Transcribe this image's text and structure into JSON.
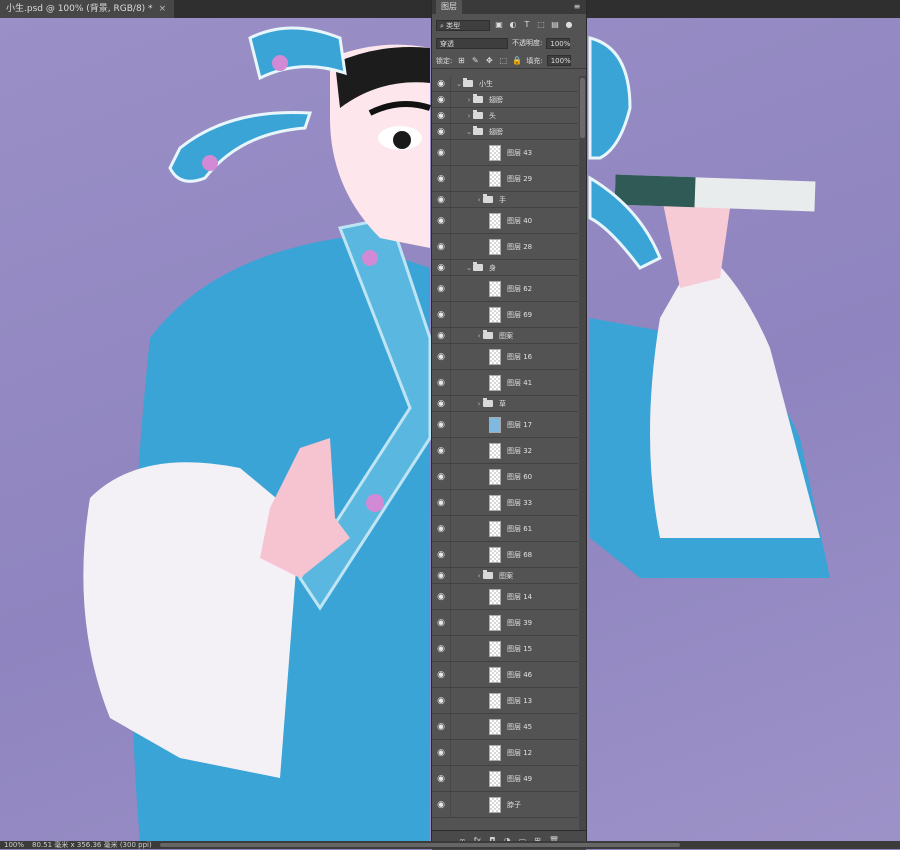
{
  "document": {
    "tab_title": "小生.psd @ 100% (背景, RGB/8) *",
    "close_glyph": "×"
  },
  "status_bar": {
    "zoom": "100%",
    "doc_size": "80.51 毫米 x 356.36 毫米 (300 ppi)"
  },
  "layers_panel": {
    "title": "图层",
    "filter_kind": "类型",
    "blend_mode": "穿透",
    "opacity_label": "不透明度:",
    "opacity_value": "100%",
    "lock_label": "锁定:",
    "fill_label": "填充:",
    "fill_value": "100%",
    "layers": [
      {
        "type": "group",
        "name": "小生",
        "indent": 0,
        "open": true
      },
      {
        "type": "group",
        "name": "翅膀",
        "indent": 1,
        "open": false
      },
      {
        "type": "group",
        "name": "头",
        "indent": 1,
        "open": false
      },
      {
        "type": "group",
        "name": "翅膀",
        "indent": 1,
        "open": true
      },
      {
        "type": "pixel",
        "name": "图层 43",
        "indent": 2
      },
      {
        "type": "pixel",
        "name": "图层 29",
        "indent": 2
      },
      {
        "type": "group",
        "name": "手",
        "indent": 2,
        "open": false
      },
      {
        "type": "pixel",
        "name": "图层 40",
        "indent": 2
      },
      {
        "type": "pixel",
        "name": "图层 28",
        "indent": 2
      },
      {
        "type": "group",
        "name": "身",
        "indent": 1,
        "open": true
      },
      {
        "type": "pixel",
        "name": "图层 62",
        "indent": 2
      },
      {
        "type": "pixel",
        "name": "图层 69",
        "indent": 2
      },
      {
        "type": "group",
        "name": "图案",
        "indent": 2,
        "open": false
      },
      {
        "type": "pixel",
        "name": "图层 16",
        "indent": 2
      },
      {
        "type": "pixel",
        "name": "图层 41",
        "indent": 2
      },
      {
        "type": "group",
        "name": "草",
        "indent": 2,
        "open": false
      },
      {
        "type": "pixel",
        "name": "图层 17",
        "indent": 2,
        "thumb": "blue"
      },
      {
        "type": "pixel",
        "name": "图层 32",
        "indent": 2
      },
      {
        "type": "pixel",
        "name": "图层 60",
        "indent": 2
      },
      {
        "type": "pixel",
        "name": "图层 33",
        "indent": 2
      },
      {
        "type": "pixel",
        "name": "图层 61",
        "indent": 2
      },
      {
        "type": "pixel",
        "name": "图层 68",
        "indent": 2
      },
      {
        "type": "group",
        "name": "图案",
        "indent": 2,
        "open": false
      },
      {
        "type": "pixel",
        "name": "图层 14",
        "indent": 2
      },
      {
        "type": "pixel",
        "name": "图层 39",
        "indent": 2
      },
      {
        "type": "pixel",
        "name": "图层 15",
        "indent": 2
      },
      {
        "type": "pixel",
        "name": "图层 46",
        "indent": 2
      },
      {
        "type": "pixel",
        "name": "图层 13",
        "indent": 2
      },
      {
        "type": "pixel",
        "name": "图层 45",
        "indent": 2
      },
      {
        "type": "pixel",
        "name": "图层 12",
        "indent": 2
      },
      {
        "type": "pixel",
        "name": "图层 49",
        "indent": 2
      },
      {
        "type": "pixel",
        "name": "脖子",
        "indent": 2
      }
    ],
    "footer_icons": [
      "link-icon",
      "fx-icon",
      "mask-icon",
      "adjustment-icon",
      "new-group-icon",
      "new-layer-icon",
      "trash-icon"
    ]
  }
}
